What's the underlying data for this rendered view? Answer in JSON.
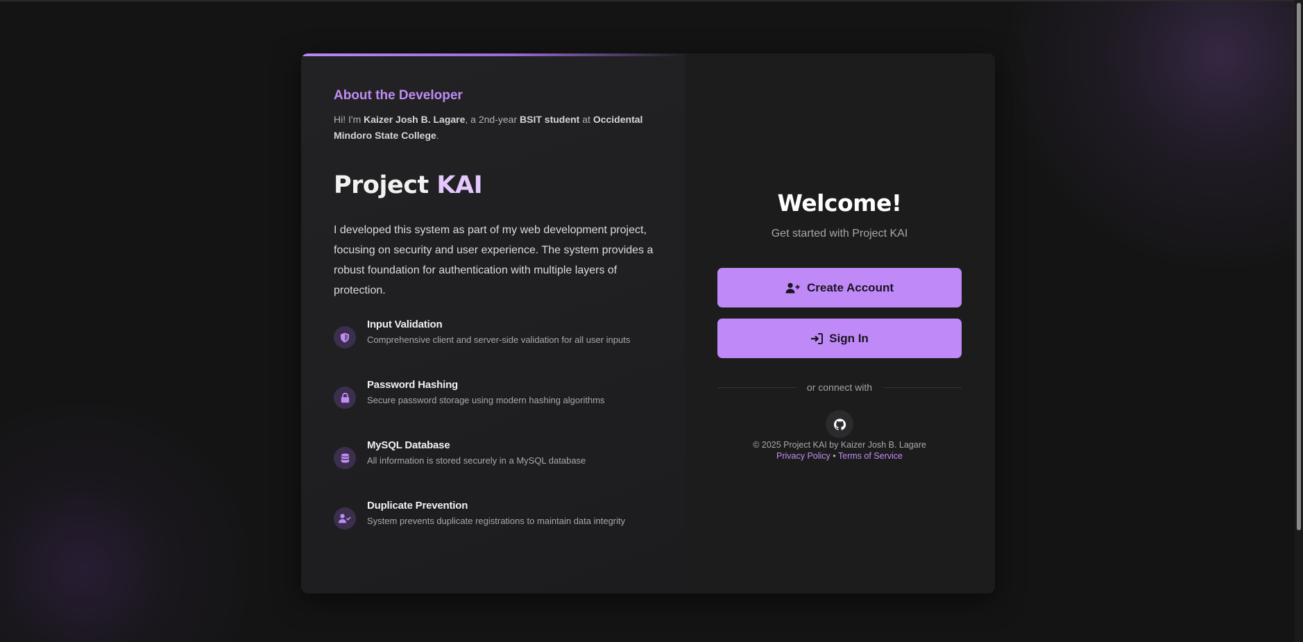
{
  "about": {
    "title": "About the Developer",
    "intro_prefix": "Hi! I'm ",
    "name": "Kaizer Josh B. Lagare",
    "intro_mid1": ", a 2nd-year ",
    "program": "BSIT student",
    "intro_mid2": " at ",
    "school": "Occidental Mindoro State College",
    "intro_end": "."
  },
  "project": {
    "title_main": "Project ",
    "title_accent": "KAI",
    "description": "I developed this system as part of my web development project, focusing on security and user experience. The system provides a robust foundation for authentication with multiple layers of protection."
  },
  "features": [
    {
      "icon": "shield-icon",
      "title": "Input Validation",
      "desc": "Comprehensive client and server-side validation for all user inputs"
    },
    {
      "icon": "lock-icon",
      "title": "Password Hashing",
      "desc": "Secure password storage using modern hashing algorithms"
    },
    {
      "icon": "database-icon",
      "title": "MySQL Database",
      "desc": "All information is stored securely in a MySQL database"
    },
    {
      "icon": "user-check-icon",
      "title": "Duplicate Prevention",
      "desc": "System prevents duplicate registrations to maintain data integrity"
    }
  ],
  "auth": {
    "welcome": "Welcome!",
    "subtitle": "Get started with Project KAI",
    "create_label": "Create Account",
    "signin_label": "Sign In",
    "divider": "or connect with"
  },
  "footer": {
    "copyright": "© 2025 Project KAI by Kaizer Josh B. Lagare",
    "privacy": "Privacy Policy",
    "sep": " • ",
    "terms": "Terms of Service"
  },
  "colors": {
    "accent": "#bf8af8",
    "heading_accent": "#c08cf5",
    "background": "#141414",
    "card": "#1d1d1f"
  }
}
